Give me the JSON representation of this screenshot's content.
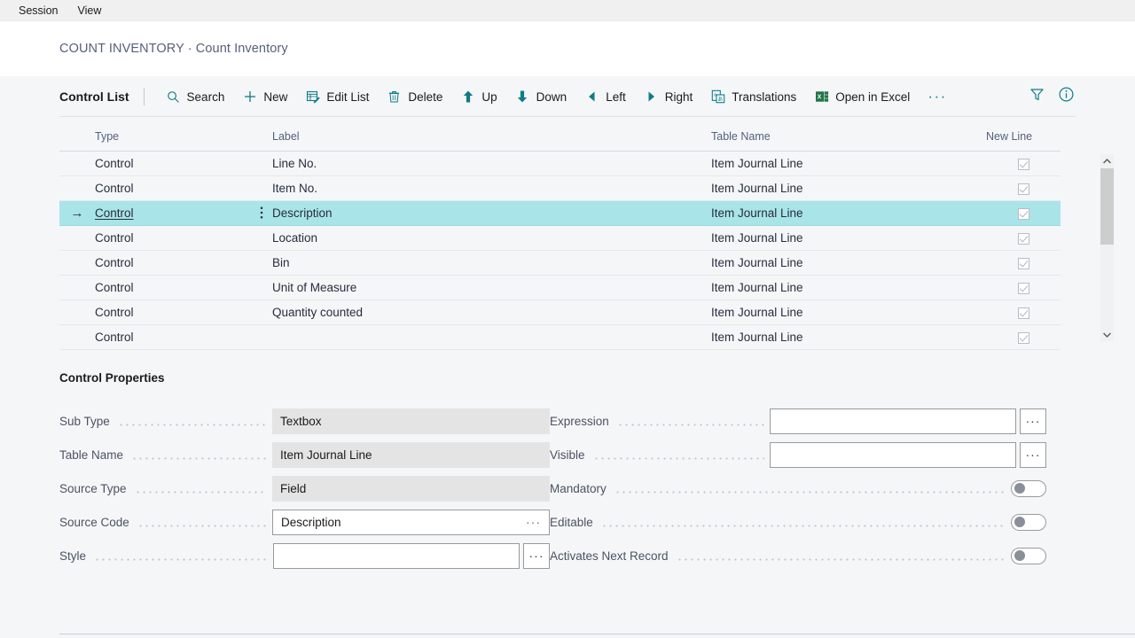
{
  "menubar": {
    "items": [
      {
        "label": "Session"
      },
      {
        "label": "View"
      }
    ]
  },
  "breadcrumb": {
    "text": "COUNT INVENTORY · Count Inventory"
  },
  "toolbar": {
    "title": "Control List",
    "buttons": [
      {
        "label": "Search",
        "icon": "search-icon"
      },
      {
        "label": "New",
        "icon": "plus-icon"
      },
      {
        "label": "Edit List",
        "icon": "edit-list-icon"
      },
      {
        "label": "Delete",
        "icon": "trash-icon"
      },
      {
        "label": "Up",
        "icon": "arrow-up-icon"
      },
      {
        "label": "Down",
        "icon": "arrow-down-icon"
      },
      {
        "label": "Left",
        "icon": "arrow-left-icon"
      },
      {
        "label": "Right",
        "icon": "arrow-right-icon"
      },
      {
        "label": "Translations",
        "icon": "translations-icon"
      },
      {
        "label": "Open in Excel",
        "icon": "excel-icon"
      }
    ],
    "overflow_label": "···",
    "filter_icon": "filter-icon",
    "info_icon": "info-icon"
  },
  "grid": {
    "columns": [
      "Type",
      "Label",
      "Table Name",
      "New Line"
    ],
    "rows": [
      {
        "type": "Control",
        "label": "Line No.",
        "table_name": "Item Journal Line",
        "new_line": true,
        "selected": false
      },
      {
        "type": "Control",
        "label": "Item No.",
        "table_name": "Item Journal Line",
        "new_line": true,
        "selected": false
      },
      {
        "type": "Control",
        "label": "Description",
        "table_name": "Item Journal Line",
        "new_line": true,
        "selected": true
      },
      {
        "type": "Control",
        "label": "Location",
        "table_name": "Item Journal Line",
        "new_line": true,
        "selected": false
      },
      {
        "type": "Control",
        "label": "Bin",
        "table_name": "Item Journal Line",
        "new_line": true,
        "selected": false
      },
      {
        "type": "Control",
        "label": "Unit of Measure",
        "table_name": "Item Journal Line",
        "new_line": true,
        "selected": false
      },
      {
        "type": "Control",
        "label": "Quantity counted",
        "table_name": "Item Journal Line",
        "new_line": true,
        "selected": false
      },
      {
        "type": "Control",
        "label": "",
        "table_name": "Item Journal Line",
        "new_line": true,
        "selected": false
      }
    ],
    "scroll_up_icon": "chevron-up-icon",
    "scroll_down_icon": "chevron-down-icon"
  },
  "properties": {
    "section_title": "Control Properties",
    "left": [
      {
        "label": "Sub Type",
        "value": "Textbox",
        "kind": "disabled"
      },
      {
        "label": "Table Name",
        "value": "Item Journal Line",
        "kind": "disabled"
      },
      {
        "label": "Source Type",
        "value": "Field",
        "kind": "disabled"
      },
      {
        "label": "Source Code",
        "value": "Description",
        "kind": "input-inline-lookup"
      },
      {
        "label": "Style",
        "value": "",
        "kind": "input-lookup"
      }
    ],
    "right": [
      {
        "label": "Expression",
        "value": "",
        "kind": "input-lookup"
      },
      {
        "label": "Visible",
        "value": "",
        "kind": "input-lookup"
      },
      {
        "label": "Mandatory",
        "value": "Off",
        "kind": "toggle"
      },
      {
        "label": "Editable",
        "value": "Off",
        "kind": "toggle"
      },
      {
        "label": "Activates Next Record",
        "value": "Off",
        "kind": "toggle"
      }
    ],
    "lookup_label": "···"
  },
  "colors": {
    "accent_teal": "#0E7C86",
    "excel_green": "#217346",
    "selected_row": "#A9E4E8",
    "page_bg": "#F5F6F8"
  }
}
